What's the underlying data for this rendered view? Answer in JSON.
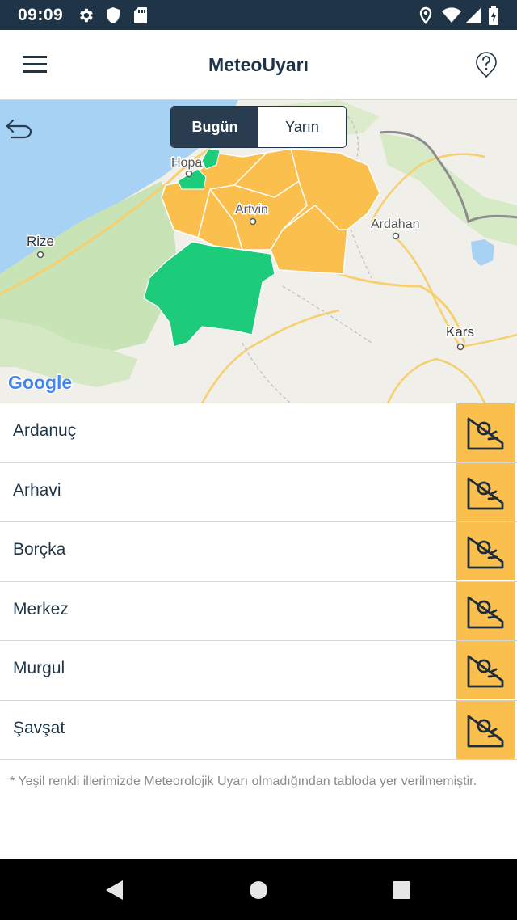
{
  "status_bar": {
    "time": "09:09"
  },
  "app_bar": {
    "title": "MeteoUyarı"
  },
  "map": {
    "toggle": {
      "today": "Bugün",
      "tomorrow": "Yarın",
      "selected": "Bugün"
    },
    "labels": {
      "hopa": "Hopa",
      "artvin": "Artvin",
      "ardahan": "Ardahan",
      "rize": "Rize",
      "kars": "Kars"
    },
    "provider": "Google",
    "colors": {
      "warning": "#fbbf4e",
      "no_warning": "#1dcc7a"
    }
  },
  "districts": [
    {
      "name": "Ardanuç",
      "icon": "landslide-warning-icon"
    },
    {
      "name": "Arhavi",
      "icon": "landslide-warning-icon"
    },
    {
      "name": "Borçka",
      "icon": "landslide-warning-icon"
    },
    {
      "name": "Merkez",
      "icon": "landslide-warning-icon"
    },
    {
      "name": "Murgul",
      "icon": "landslide-warning-icon"
    },
    {
      "name": "Şavşat",
      "icon": "landslide-warning-icon"
    }
  ],
  "footnote": "* Yeşil renkli illerimizde Meteorolojik Uyarı olmadığından tabloda yer verilmemiştir."
}
